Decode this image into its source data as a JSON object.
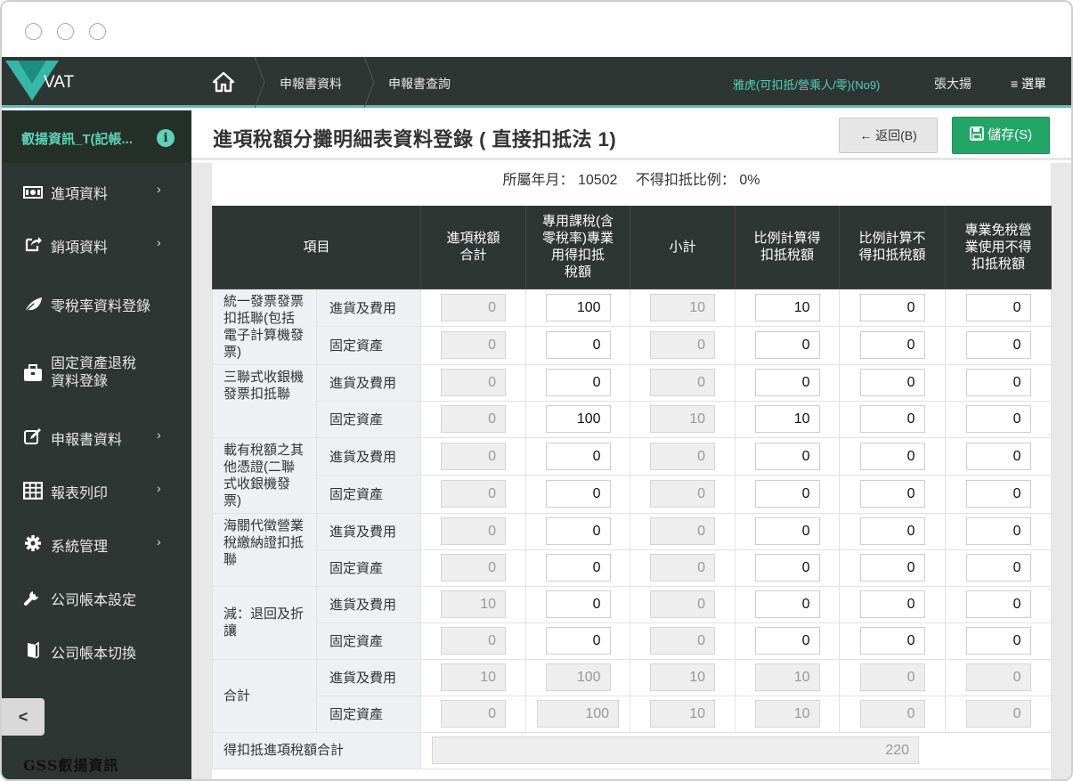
{
  "topnav": {
    "app_name": "VAT",
    "breadcrumbs": [
      "申報書資料",
      "申報書查詢"
    ],
    "company": "雅虎(可扣抵/營乘人/零)(No9)",
    "user": "張大揚",
    "menu_label": "≡ 選單"
  },
  "sidebar": {
    "header_label": "叡揚資訊_T(記帳...",
    "items": [
      {
        "label": "進項資料",
        "icon": "money-icon",
        "has_arrow": true
      },
      {
        "label": "銷項資料",
        "icon": "share-icon",
        "has_arrow": true
      },
      {
        "label": "零稅率資料登錄",
        "icon": "leaf-icon",
        "has_arrow": false
      },
      {
        "label": "固定資產退稅",
        "label2": "資料登錄",
        "icon": "briefcase-icon",
        "has_arrow": false
      },
      {
        "label": "申報書資料",
        "icon": "edit-icon",
        "has_arrow": true
      },
      {
        "label": "報表列印",
        "icon": "table-icon",
        "has_arrow": true
      },
      {
        "label": "系統管理",
        "icon": "gear-icon",
        "has_arrow": true
      },
      {
        "label": "公司帳本設定",
        "icon": "wrench-icon",
        "has_arrow": false
      },
      {
        "label": "公司帳本切換",
        "icon": "book-icon",
        "has_arrow": false
      }
    ],
    "collapse_label": "<",
    "brand": "GSS叡揚資訊"
  },
  "header": {
    "title": "進項稅額分攤明細表資料登錄 ( 直接扣抵法 1)",
    "back_label": "返回(B)",
    "save_label": "儲存(S)"
  },
  "period": {
    "text": "所屬年月： 10502　 不得扣抵比例： 0%"
  },
  "table": {
    "headers": [
      "項目",
      "進項稅額合計",
      "專用課稅(含零稅率)專業用得扣抵稅額",
      "小計",
      "比例計算得扣抵稅額",
      "比例計算不得扣抵稅額",
      "專業免稅營業使用不得扣抵稅額"
    ],
    "groups": [
      {
        "category": "統一發票發票扣抵聯(包括電子計算機發票)",
        "rows": [
          {
            "sub": "進貨及費用",
            "values": [
              "0",
              "100",
              "10",
              "10",
              "0",
              "0"
            ]
          },
          {
            "sub": "固定資產",
            "values": [
              "0",
              "0",
              "0",
              "0",
              "0",
              "0"
            ]
          }
        ]
      },
      {
        "category": "三聯式收銀機發票扣抵聯",
        "rows": [
          {
            "sub": "進貨及費用",
            "values": [
              "0",
              "0",
              "0",
              "0",
              "0",
              "0"
            ]
          },
          {
            "sub": "固定資產",
            "values": [
              "0",
              "100",
              "10",
              "10",
              "0",
              "0"
            ]
          }
        ]
      },
      {
        "category": "載有稅額之其他憑證(二聯式收銀機發票)",
        "rows": [
          {
            "sub": "進貨及費用",
            "values": [
              "0",
              "0",
              "0",
              "0",
              "0",
              "0"
            ]
          },
          {
            "sub": "固定資產",
            "values": [
              "0",
              "0",
              "0",
              "0",
              "0",
              "0"
            ]
          }
        ]
      },
      {
        "category": "海關代徵營業稅繳納證扣抵聯",
        "rows": [
          {
            "sub": "進貨及費用",
            "values": [
              "0",
              "0",
              "0",
              "0",
              "0",
              "0"
            ]
          },
          {
            "sub": "固定資產",
            "values": [
              "0",
              "0",
              "0",
              "0",
              "0",
              "0"
            ]
          }
        ]
      },
      {
        "category": "減：退回及折讓",
        "rows": [
          {
            "sub": "進貨及費用",
            "values": [
              "10",
              "0",
              "0",
              "0",
              "0",
              "0"
            ]
          },
          {
            "sub": "固定資產",
            "values": [
              "0",
              "0",
              "0",
              "0",
              "0",
              "0"
            ]
          }
        ]
      },
      {
        "category": "合計",
        "rows": [
          {
            "sub": "進貨及費用",
            "values": [
              "10",
              "100",
              "10",
              "10",
              "0",
              "0"
            ]
          },
          {
            "sub": "固定資產",
            "values": [
              "0",
              "100",
              "10",
              "10",
              "0",
              "0"
            ]
          }
        ]
      }
    ],
    "deductible_total_label": "得扣抵進項稅額合計",
    "deductible_total_value": "220"
  }
}
